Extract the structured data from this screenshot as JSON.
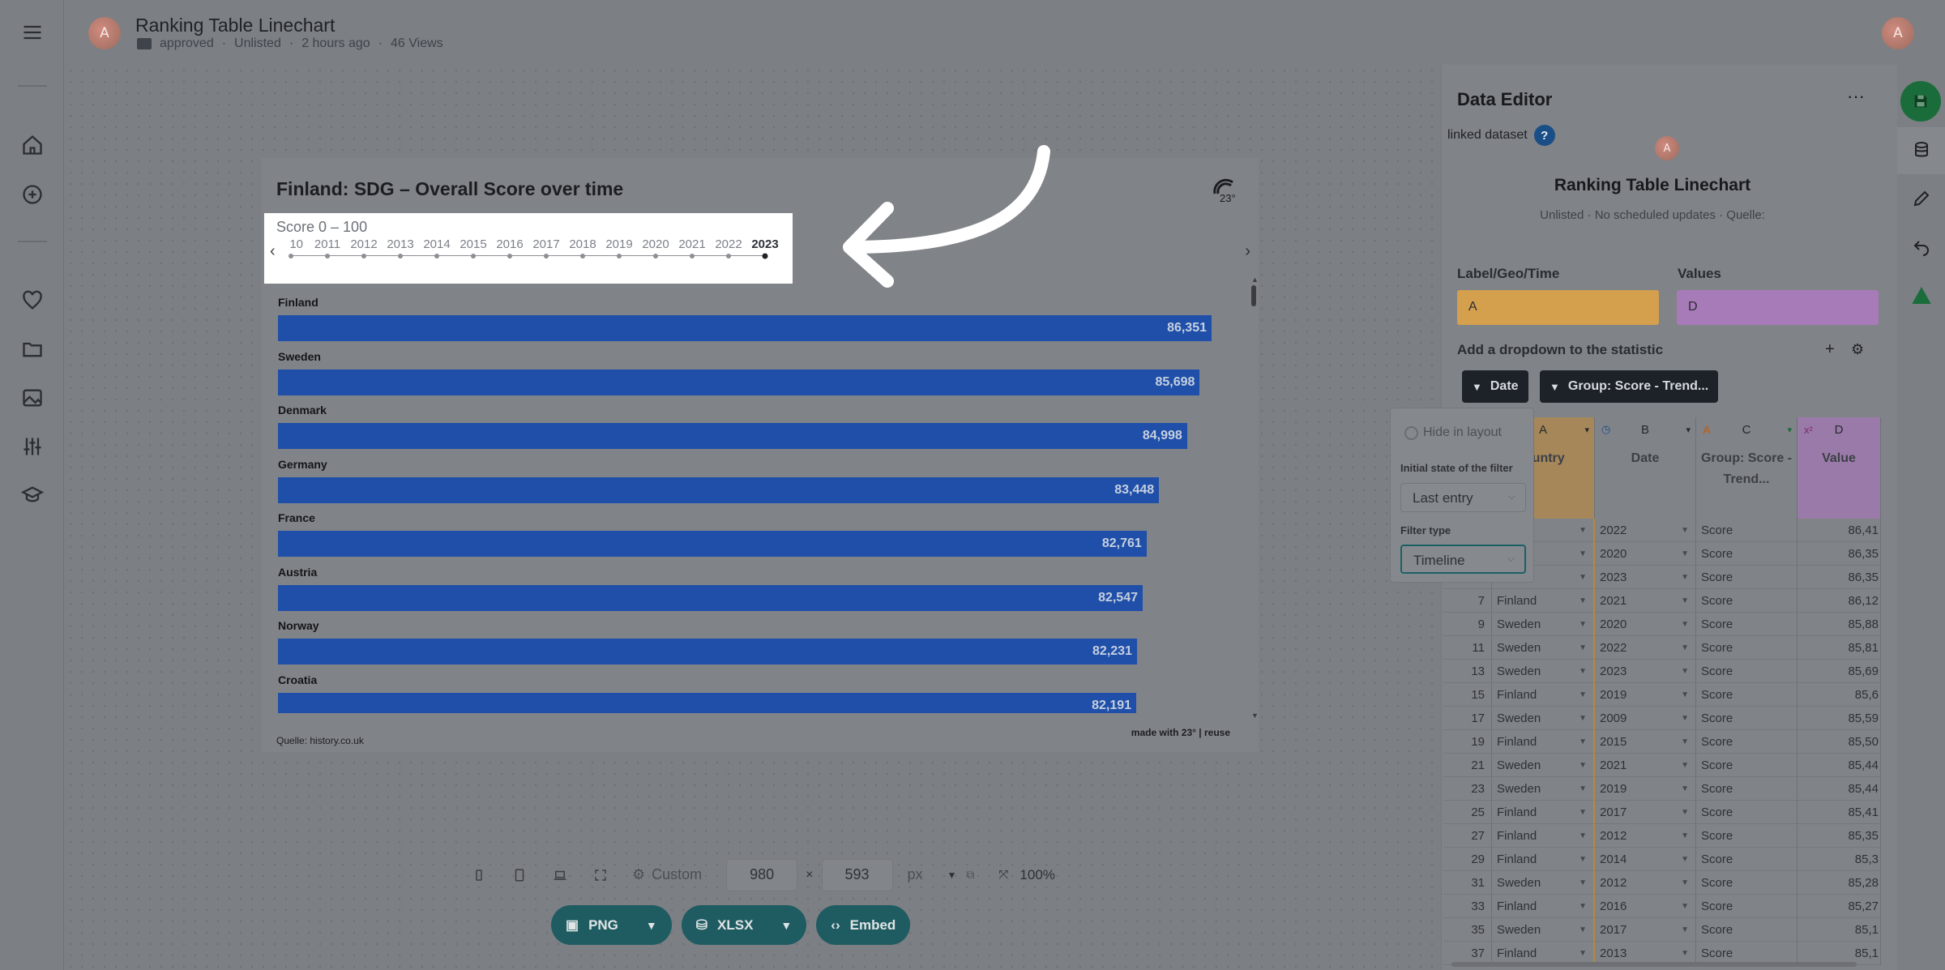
{
  "header": {
    "title": "Ranking Table Linechart",
    "avatar_letter": "A",
    "folder": "approved",
    "visibility": "Unlisted",
    "updated": "2 hours ago",
    "views": "46 Views"
  },
  "sidebar": {
    "icons": [
      "menu-icon",
      "home-icon",
      "add-icon",
      "heart-icon",
      "folder-icon",
      "image-icon",
      "sliders-icon",
      "graduation-icon"
    ]
  },
  "chart": {
    "title": "Finland: SDG – Overall Score over time",
    "logo": "23°",
    "score_label": "Score 0 – 100",
    "years": [
      "2010",
      "2011",
      "2012",
      "2013",
      "2014",
      "2015",
      "2016",
      "2017",
      "2018",
      "2019",
      "2020",
      "2021",
      "2022",
      "2023"
    ],
    "first_year_visible": "10",
    "selected_year": "2023",
    "source": "Quelle: history.co.uk",
    "made_with": "made with 23° | reuse"
  },
  "chart_data": {
    "type": "bar",
    "orientation": "horizontal",
    "categories": [
      "Finland",
      "Sweden",
      "Denmark",
      "Germany",
      "France",
      "Austria",
      "Norway",
      "Croatia"
    ],
    "values": [
      86.351,
      85.698,
      84.998,
      83.448,
      82.761,
      82.547,
      82.231,
      82.191
    ],
    "value_labels": [
      "86,351",
      "85,698",
      "84,998",
      "83,448",
      "82,761",
      "82,547",
      "82,231",
      "82,191"
    ],
    "bar_color": "#1f4fa8"
  },
  "toolbar": {
    "custom_label": "Custom",
    "width": "980",
    "times": "×",
    "height": "593",
    "unit": "px",
    "zoom": "100%",
    "export_png": "PNG",
    "export_xlsx": "XLSX",
    "embed": "Embed"
  },
  "panel": {
    "title": "Data Editor",
    "linked_dataset": "linked dataset",
    "help": "?",
    "avatar_letter": "A",
    "name": "Ranking Table Linechart",
    "subtitle": "Unlisted · No scheduled updates · Quelle:",
    "label_geo_time": "Label/Geo/Time",
    "values_label": "Values",
    "label_col": "A",
    "values_col": "D",
    "label_col_color": "#d4a04e",
    "values_col_color": "#a77ab8",
    "add_dropdown": "Add a dropdown to the statistic",
    "chip_date": "Date",
    "chip_group": "Group: Score - Trend..."
  },
  "popover": {
    "hide": "Hide in layout",
    "initial_state_label": "Initial state of the filter",
    "initial_state": "Last entry",
    "filter_type_label": "Filter type",
    "filter_type": "Timeline"
  },
  "grid": {
    "col_a": "A",
    "col_b": "B",
    "col_c": "C",
    "col_d": "D",
    "head_a": "...untry",
    "head_b": "Date",
    "head_c": "Group: Score - Trend...",
    "head_d": "Value",
    "rows": [
      {
        "i": "",
        "a": "...d",
        "b": "2022",
        "c": "Score",
        "d": "86,41"
      },
      {
        "i": "",
        "a": "...d",
        "b": "2020",
        "c": "Score",
        "d": "86,35"
      },
      {
        "i": "",
        "a": "...d",
        "b": "2023",
        "c": "Score",
        "d": "86,35"
      },
      {
        "i": "7",
        "a": "Finland",
        "b": "2021",
        "c": "Score",
        "d": "86,12"
      },
      {
        "i": "9",
        "a": "Sweden",
        "b": "2020",
        "c": "Score",
        "d": "85,88"
      },
      {
        "i": "11",
        "a": "Sweden",
        "b": "2022",
        "c": "Score",
        "d": "85,81"
      },
      {
        "i": "13",
        "a": "Sweden",
        "b": "2023",
        "c": "Score",
        "d": "85,69"
      },
      {
        "i": "15",
        "a": "Finland",
        "b": "2019",
        "c": "Score",
        "d": "85,6"
      },
      {
        "i": "17",
        "a": "Sweden",
        "b": "2009",
        "c": "Score",
        "d": "85,59"
      },
      {
        "i": "19",
        "a": "Finland",
        "b": "2015",
        "c": "Score",
        "d": "85,50"
      },
      {
        "i": "21",
        "a": "Sweden",
        "b": "2021",
        "c": "Score",
        "d": "85,44"
      },
      {
        "i": "23",
        "a": "Sweden",
        "b": "2019",
        "c": "Score",
        "d": "85,44"
      },
      {
        "i": "25",
        "a": "Finland",
        "b": "2017",
        "c": "Score",
        "d": "85,41"
      },
      {
        "i": "27",
        "a": "Finland",
        "b": "2012",
        "c": "Score",
        "d": "85,35"
      },
      {
        "i": "29",
        "a": "Finland",
        "b": "2014",
        "c": "Score",
        "d": "85,3"
      },
      {
        "i": "31",
        "a": "Sweden",
        "b": "2012",
        "c": "Score",
        "d": "85,28"
      },
      {
        "i": "33",
        "a": "Finland",
        "b": "2016",
        "c": "Score",
        "d": "85,27"
      },
      {
        "i": "35",
        "a": "Sweden",
        "b": "2017",
        "c": "Score",
        "d": "85,1"
      },
      {
        "i": "37",
        "a": "Finland",
        "b": "2013",
        "c": "Score",
        "d": "85,1"
      }
    ]
  }
}
